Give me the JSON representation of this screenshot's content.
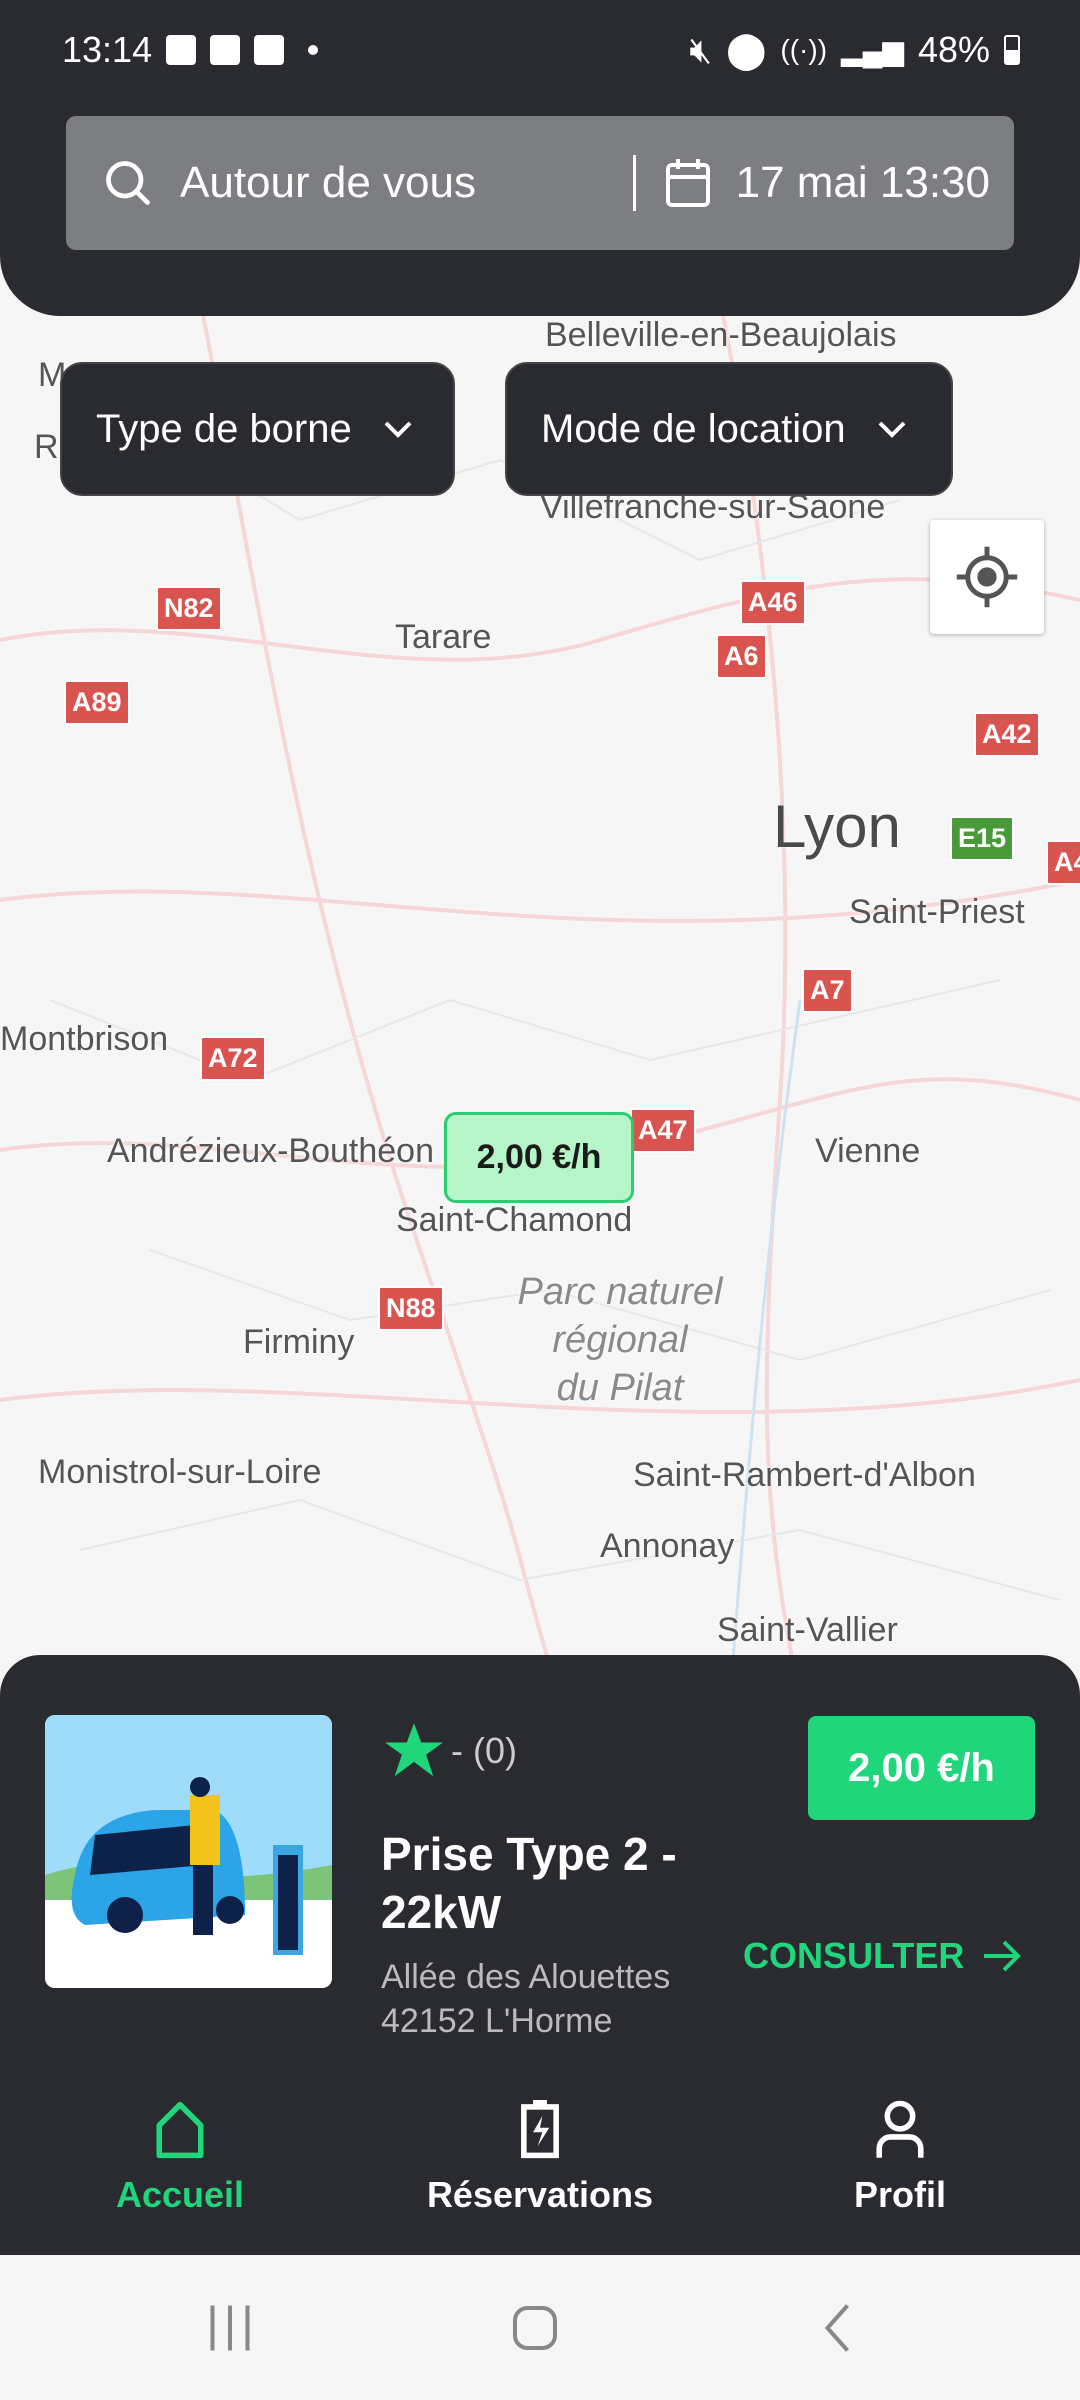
{
  "status_bar": {
    "time": "13:14",
    "battery": "48%",
    "icons": [
      "gallery-icon",
      "outlook-icon",
      "tasks-icon",
      "dot-icon",
      "mute-icon",
      "location-icon",
      "wifi-icon",
      "wifi-call-icon",
      "signal-icon",
      "battery-icon"
    ]
  },
  "search": {
    "placeholder": "Autour de vous",
    "date": "17 mai 13:30"
  },
  "filters": [
    {
      "label": "Type de borne"
    },
    {
      "label": "Mode de location"
    }
  ],
  "map": {
    "places": [
      "Belleville-en-Beaujolais",
      "Villefranche-sur-Saone",
      "Tarare",
      "Lyon",
      "Saint-Priest",
      "Montbrison",
      "Andrézieux-Bouthéon",
      "Saint-Chamond",
      "Vienne",
      "Firminy",
      "Monistrol-sur-Loire",
      "Saint-Rambert-d'Albon",
      "Annonay",
      "Saint-Vallier",
      "M",
      "R"
    ],
    "park": [
      "Parc naturel",
      "régional",
      "du Pilat"
    ],
    "roads": [
      "N82",
      "A89",
      "A46",
      "A6",
      "A42",
      "E15",
      "A4",
      "A7",
      "A72",
      "A47",
      "N88"
    ],
    "marker_price": "2,00 €/h"
  },
  "station": {
    "rating": "- (0)",
    "title": "Prise Type 2 - 22kW",
    "address_line1": "Allée des Alouettes",
    "address_line2": "42152 L'Horme",
    "price": "2,00 €/h",
    "consult": "CONSULTER"
  },
  "nav": [
    {
      "label": "Accueil",
      "icon": "home-icon",
      "active": true
    },
    {
      "label": "Réservations",
      "icon": "battery-charge-icon"
    },
    {
      "label": "Profil",
      "icon": "person-icon"
    }
  ],
  "colors": {
    "accent": "#20d67b",
    "dark": "#2a2b30",
    "marker_bg": "#b6f5c8"
  }
}
